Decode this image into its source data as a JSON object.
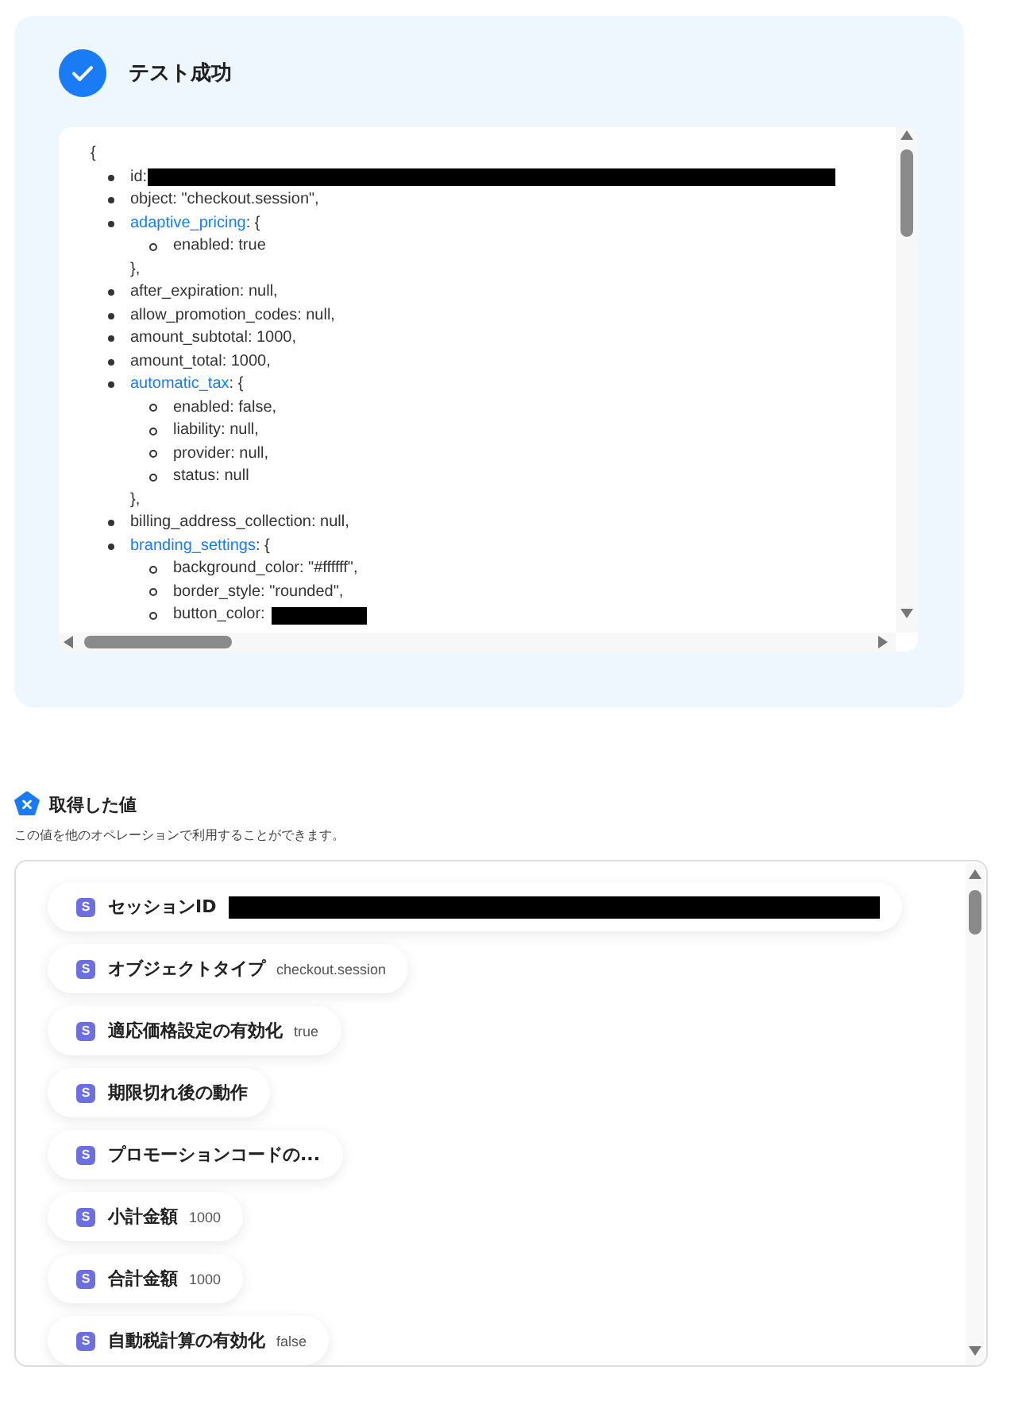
{
  "result_panel": {
    "success": true,
    "title": "テスト成功",
    "code_view": {
      "open": "{",
      "items": [
        {
          "text": "id:",
          "redacted": true
        },
        {
          "text": "object: \"checkout.session\","
        },
        {
          "key": "adaptive_pricing",
          "suffix": ": {",
          "children": [
            {
              "text": "enabled: true"
            }
          ],
          "close": "},"
        },
        {
          "text": "after_expiration: null,"
        },
        {
          "text": "allow_promotion_codes: null,"
        },
        {
          "text": "amount_subtotal: 1000,"
        },
        {
          "text": "amount_total: 1000,"
        },
        {
          "key": "automatic_tax",
          "suffix": ": {",
          "children": [
            {
              "text": "enabled: false,"
            },
            {
              "text": "liability: null,"
            },
            {
              "text": "provider: null,"
            },
            {
              "text": "status: null"
            }
          ],
          "close": "},"
        },
        {
          "text": "billing_address_collection: null,"
        },
        {
          "key": "branding_settings",
          "suffix": ": {",
          "children": [
            {
              "text": "background_color: \"#ffffff\","
            },
            {
              "text": "border_style: \"rounded\","
            },
            {
              "text": "button_color:",
              "redacted": true
            }
          ]
        }
      ]
    }
  },
  "values_section": {
    "title": "取得した値",
    "description": "この値を他のオペレーションで利用することができます。",
    "items": [
      {
        "badge": "S",
        "label": "セッションID",
        "redacted": true
      },
      {
        "badge": "S",
        "label": "オブジェクトタイプ",
        "value": "checkout.session"
      },
      {
        "badge": "S",
        "label": "適応価格設定の有効化",
        "value": "true"
      },
      {
        "badge": "S",
        "label": "期限切れ後の動作"
      },
      {
        "badge": "S",
        "label": "プロモーションコードの..."
      },
      {
        "badge": "S",
        "label": "小計金額",
        "value": "1000"
      },
      {
        "badge": "S",
        "label": "合計金額",
        "value": "1000"
      },
      {
        "badge": "S",
        "label": "自動税計算の有効化",
        "value": "false"
      }
    ]
  }
}
